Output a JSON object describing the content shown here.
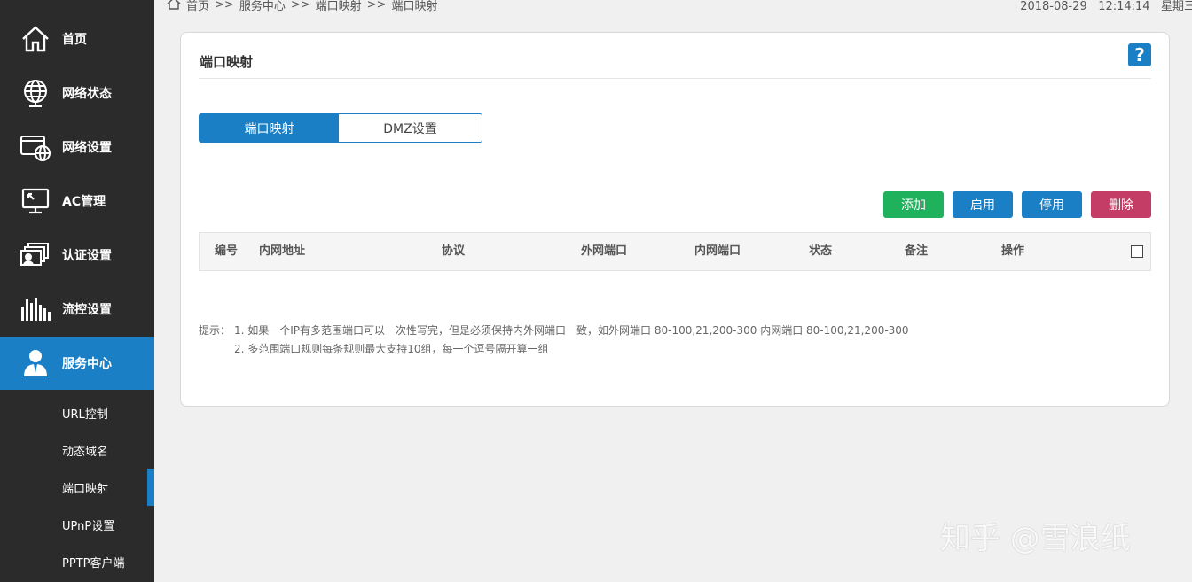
{
  "sidebar": {
    "items": [
      {
        "label": "首页",
        "icon": "home-icon"
      },
      {
        "label": "网络状态",
        "icon": "globe-icon"
      },
      {
        "label": "网络设置",
        "icon": "network-settings-icon"
      },
      {
        "label": "AC管理",
        "icon": "monitor-icon"
      },
      {
        "label": "认证设置",
        "icon": "auth-icon"
      },
      {
        "label": "流控设置",
        "icon": "bars-icon"
      },
      {
        "label": "服务中心",
        "icon": "user-service-icon"
      }
    ],
    "active_item": "服务中心",
    "sub_items": [
      {
        "label": "URL控制"
      },
      {
        "label": "动态域名"
      },
      {
        "label": "端口映射"
      },
      {
        "label": "UPnP设置"
      },
      {
        "label": "PPTP客户端"
      }
    ],
    "active_sub_item": "端口映射"
  },
  "header": {
    "breadcrumb": [
      "首页",
      ">>",
      "服务中心",
      ">>",
      "端口映射",
      ">>",
      "端口映射"
    ],
    "date": "2018-08-29",
    "time": "12:14:14",
    "weekday": "星期三"
  },
  "panel": {
    "title": "端口映射",
    "help_label": "?",
    "tabs": [
      {
        "label": "端口映射",
        "active": true
      },
      {
        "label": "DMZ设置",
        "active": false
      }
    ],
    "buttons": {
      "add": "添加",
      "enable": "启用",
      "disable": "停用",
      "delete": "删除"
    },
    "table_headers": [
      "编号",
      "内网地址",
      "协议",
      "外网端口",
      "内网端口",
      "状态",
      "备注",
      "操作"
    ],
    "tips": {
      "prefix": "提示：",
      "lines": [
        "1. 如果一个IP有多范围端口可以一次性写完，但是必须保持内外网端口一致，如外网端口 80-100,21,200-300 内网端口 80-100,21,200-300",
        "2. 多范围端口规则每条规则最大支持10组，每一个逗号隔开算一组"
      ]
    }
  },
  "watermark": "知乎 @雪浪纸",
  "colors": {
    "sidebar_bg": "#2b2b2b",
    "accent": "#1a7fc4",
    "add_green": "#1fb15c",
    "delete_red": "#c43d66"
  }
}
